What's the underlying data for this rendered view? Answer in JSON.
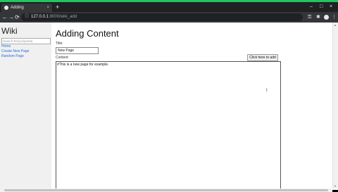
{
  "browser": {
    "tab_title": "Adding",
    "tab_close": "×",
    "new_tab": "+",
    "window_controls": {
      "minimize": "–",
      "maximize": "□",
      "close": "×"
    },
    "nav": {
      "back": "←",
      "forward": "→",
      "reload": "⟳"
    },
    "url_host": "127.0.0.1",
    "url_path": ":8000/wiki_add",
    "site_info_icon": "info-icon"
  },
  "sidebar": {
    "title": "Wiki",
    "search_placeholder": "Search Encyclopedia",
    "links": [
      "Home",
      "Create New Page",
      "Random Page"
    ]
  },
  "main": {
    "heading": "Adding Content",
    "title_label": "Title:",
    "title_value": "New Page",
    "add_button": "Click here to add",
    "content_label": "Content:",
    "content_value": "#This is a new page for example."
  },
  "colors": {
    "top_strip": "#22c55e",
    "link": "#2a6fd6",
    "chrome_dark": "#202124"
  }
}
